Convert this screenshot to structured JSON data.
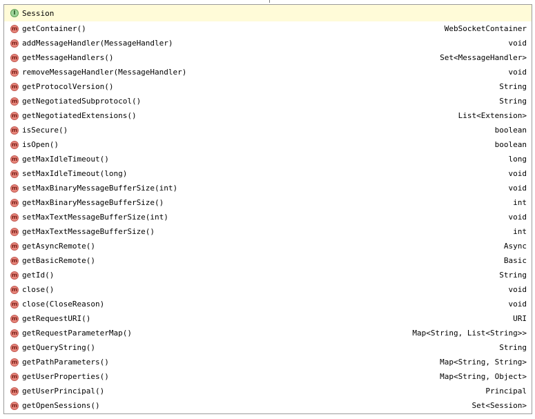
{
  "header": {
    "icon": "interface-icon",
    "badge_letter": "I",
    "title": "Session"
  },
  "method_badge_letter": "m",
  "methods": [
    {
      "name": "getContainer()",
      "returns": "WebSocketContainer"
    },
    {
      "name": "addMessageHandler(MessageHandler)",
      "returns": "void"
    },
    {
      "name": "getMessageHandlers()",
      "returns": "Set<MessageHandler>"
    },
    {
      "name": "removeMessageHandler(MessageHandler)",
      "returns": "void"
    },
    {
      "name": "getProtocolVersion()",
      "returns": "String"
    },
    {
      "name": "getNegotiatedSubprotocol()",
      "returns": "String"
    },
    {
      "name": "getNegotiatedExtensions()",
      "returns": "List<Extension>"
    },
    {
      "name": "isSecure()",
      "returns": "boolean"
    },
    {
      "name": "isOpen()",
      "returns": "boolean"
    },
    {
      "name": "getMaxIdleTimeout()",
      "returns": "long"
    },
    {
      "name": "setMaxIdleTimeout(long)",
      "returns": "void"
    },
    {
      "name": "setMaxBinaryMessageBufferSize(int)",
      "returns": "void"
    },
    {
      "name": "getMaxBinaryMessageBufferSize()",
      "returns": "int"
    },
    {
      "name": "setMaxTextMessageBufferSize(int)",
      "returns": "void"
    },
    {
      "name": "getMaxTextMessageBufferSize()",
      "returns": "int"
    },
    {
      "name": "getAsyncRemote()",
      "returns": "Async"
    },
    {
      "name": "getBasicRemote()",
      "returns": "Basic"
    },
    {
      "name": "getId()",
      "returns": "String"
    },
    {
      "name": "close()",
      "returns": "void"
    },
    {
      "name": "close(CloseReason)",
      "returns": "void"
    },
    {
      "name": "getRequestURI()",
      "returns": "URI"
    },
    {
      "name": "getRequestParameterMap()",
      "returns": "Map<String, List<String>>"
    },
    {
      "name": "getQueryString()",
      "returns": "String"
    },
    {
      "name": "getPathParameters()",
      "returns": "Map<String, String>"
    },
    {
      "name": "getUserProperties()",
      "returns": "Map<String, Object>"
    },
    {
      "name": "getUserPrincipal()",
      "returns": "Principal"
    },
    {
      "name": "getOpenSessions()",
      "returns": "Set<Session>"
    }
  ]
}
